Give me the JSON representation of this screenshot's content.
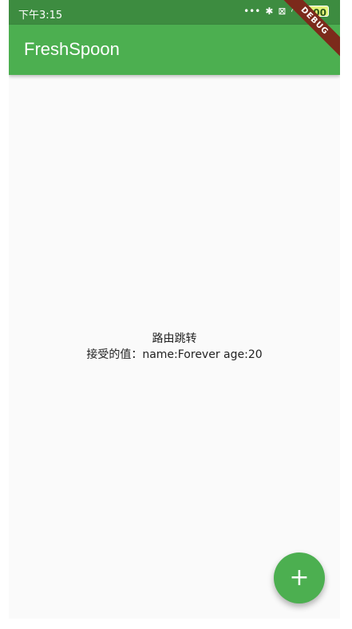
{
  "status_bar": {
    "time": "下午3:15",
    "icons": [
      "more-dots-icon",
      "bluetooth-icon",
      "sim-icon",
      "wifi-icon",
      "battery-icon"
    ],
    "battery_level": "100"
  },
  "app_bar": {
    "title": "FreshSpoon"
  },
  "debug_banner": {
    "label": "DEBUG"
  },
  "main": {
    "line1": "路由跳转",
    "line2": "接受的值：name:Forever age:20"
  },
  "fab": {
    "icon": "plus-icon",
    "symbol": "+"
  },
  "colors": {
    "primary": "#4caf50",
    "primary_dark": "#3d8c40",
    "background": "#fafafa",
    "debug": "#7c2a1b"
  }
}
